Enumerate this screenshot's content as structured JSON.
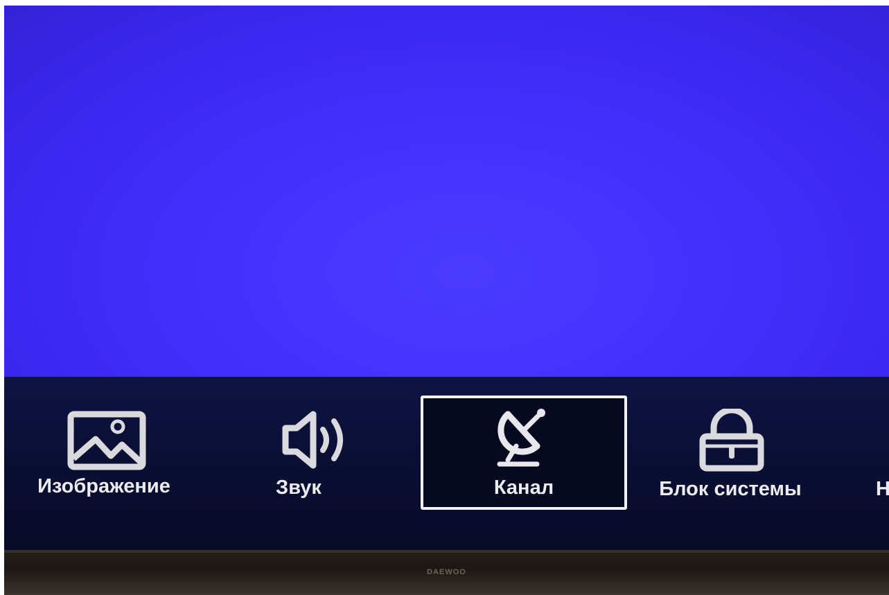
{
  "tv": {
    "brand": "DAEWOO",
    "screen_color": "#4532ff"
  },
  "menu": {
    "selected_index": 2,
    "items": [
      {
        "label": "Изображение",
        "icon": "picture-icon"
      },
      {
        "label": "Звук",
        "icon": "speaker-icon"
      },
      {
        "label": "Канал",
        "icon": "satellite-dish-icon"
      },
      {
        "label": "Блок системы",
        "icon": "lock-icon"
      },
      {
        "label": "Н",
        "icon": ""
      }
    ]
  }
}
